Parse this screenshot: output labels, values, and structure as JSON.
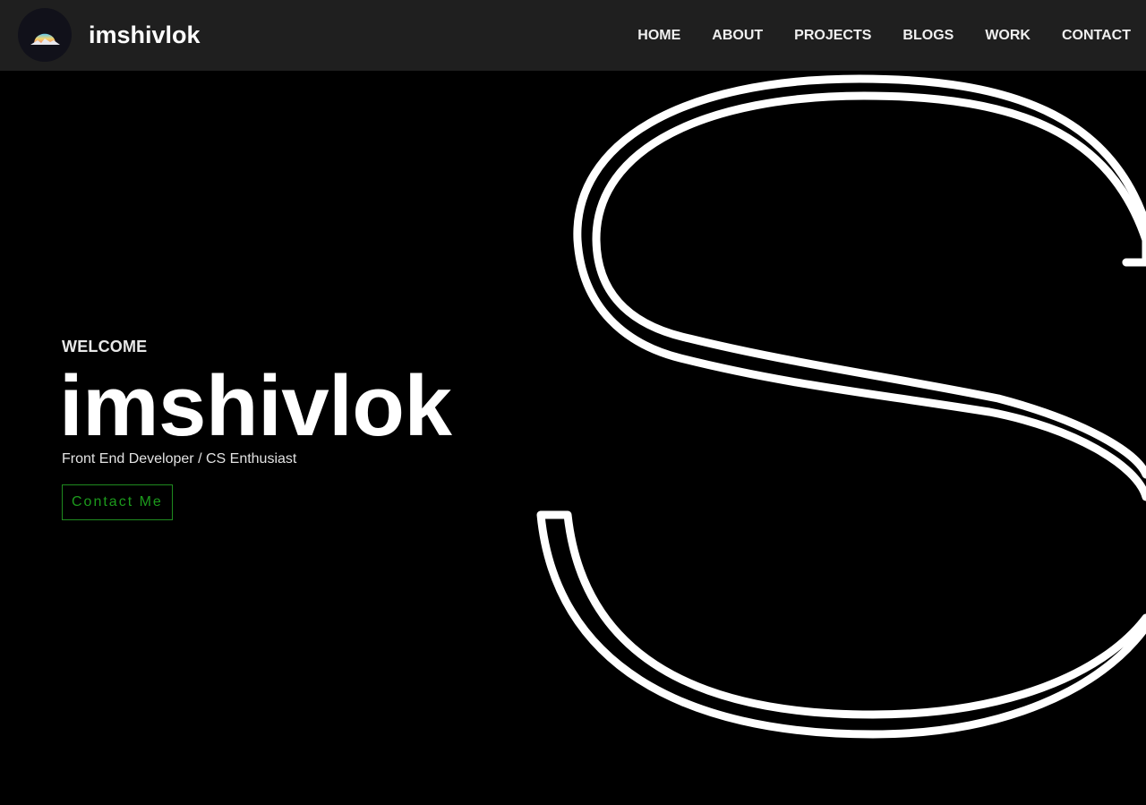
{
  "header": {
    "logo_icon": "sunrise-mountain-logo-icon",
    "brand": "imshivlok"
  },
  "nav": {
    "items": [
      "HOME",
      "ABOUT",
      "PROJECTS",
      "BLOGS",
      "WORK",
      "CONTACT"
    ]
  },
  "hero": {
    "welcome": "WELCOME",
    "name": "imshivlok",
    "tagline": "Front End Developer / CS Enthusiast",
    "cta_label": "Contact Me",
    "background_glyph": "S"
  },
  "colors": {
    "navbar_bg": "#1f1f1f",
    "page_bg": "#000000",
    "cta_accent": "#1c9a1c",
    "text_primary": "#ffffff"
  }
}
